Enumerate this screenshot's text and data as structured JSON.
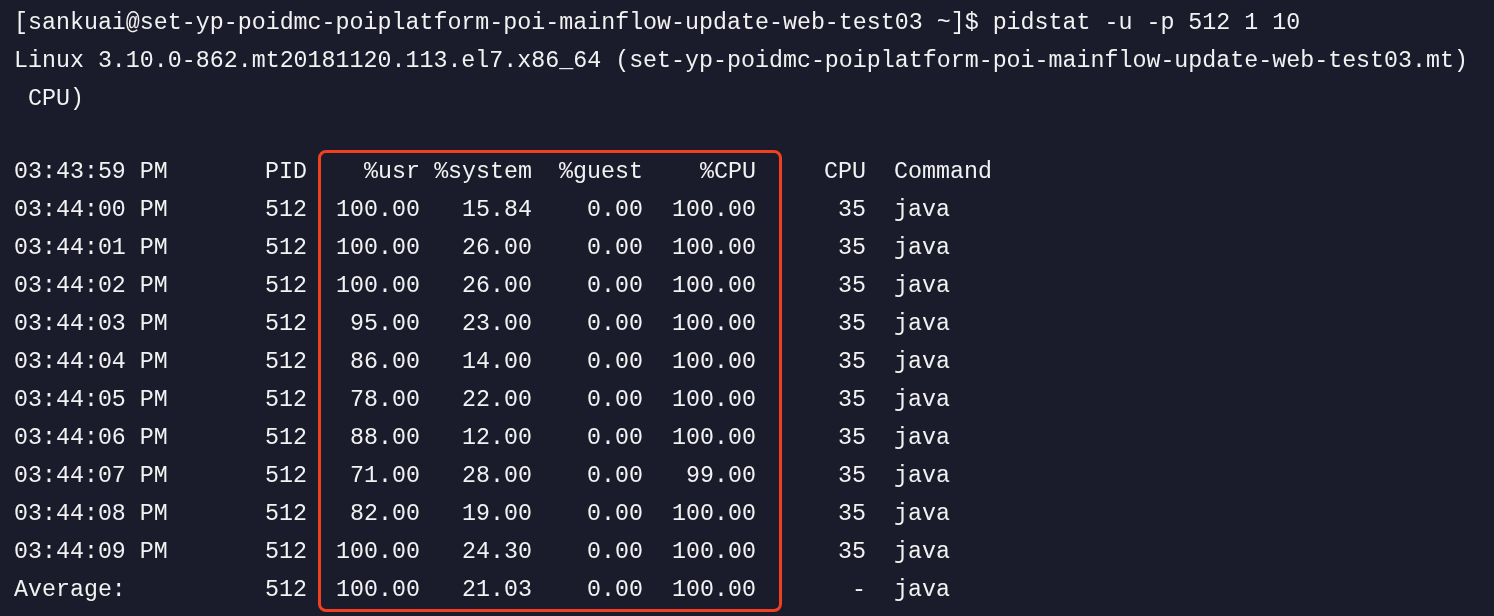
{
  "terminal": {
    "lines": [
      "[sankuai@set-yp-poidmc-poiplatform-poi-mainflow-update-web-test03 ~]$ pidstat -u -p 512 1 10",
      "Linux 3.10.0-862.mt20181120.113.el7.x86_64 (set-yp-poidmc-poiplatform-poi-mainflow-update-web-test03.mt)",
      " CPU)"
    ],
    "table": {
      "columns": [
        {
          "header": "03:43:59 PM",
          "highlighted": false
        },
        {
          "header": "PID",
          "highlighted": false
        },
        {
          "header": "%usr",
          "highlighted": true
        },
        {
          "header": "%system",
          "highlighted": true
        },
        {
          "header": "%guest",
          "highlighted": true
        },
        {
          "header": "%CPU",
          "highlighted": true
        },
        {
          "header": "CPU",
          "highlighted": false
        },
        {
          "header": "Command",
          "highlighted": false
        }
      ],
      "rows": [
        [
          "03:44:00 PM",
          "512",
          "100.00",
          "15.84",
          "0.00",
          "100.00",
          "35",
          "java"
        ],
        [
          "03:44:01 PM",
          "512",
          "100.00",
          "26.00",
          "0.00",
          "100.00",
          "35",
          "java"
        ],
        [
          "03:44:02 PM",
          "512",
          "100.00",
          "26.00",
          "0.00",
          "100.00",
          "35",
          "java"
        ],
        [
          "03:44:03 PM",
          "512",
          "95.00",
          "23.00",
          "0.00",
          "100.00",
          "35",
          "java"
        ],
        [
          "03:44:04 PM",
          "512",
          "86.00",
          "14.00",
          "0.00",
          "100.00",
          "35",
          "java"
        ],
        [
          "03:44:05 PM",
          "512",
          "78.00",
          "22.00",
          "0.00",
          "100.00",
          "35",
          "java"
        ],
        [
          "03:44:06 PM",
          "512",
          "88.00",
          "12.00",
          "0.00",
          "100.00",
          "35",
          "java"
        ],
        [
          "03:44:07 PM",
          "512",
          "71.00",
          "28.00",
          "0.00",
          "99.00",
          "35",
          "java"
        ],
        [
          "03:44:08 PM",
          "512",
          "82.00",
          "19.00",
          "0.00",
          "100.00",
          "35",
          "java"
        ],
        [
          "03:44:09 PM",
          "512",
          "100.00",
          "24.30",
          "0.00",
          "100.00",
          "35",
          "java"
        ],
        [
          "Average:",
          "512",
          "100.00",
          "21.03",
          "0.00",
          "100.00",
          "-",
          "java"
        ]
      ]
    }
  }
}
